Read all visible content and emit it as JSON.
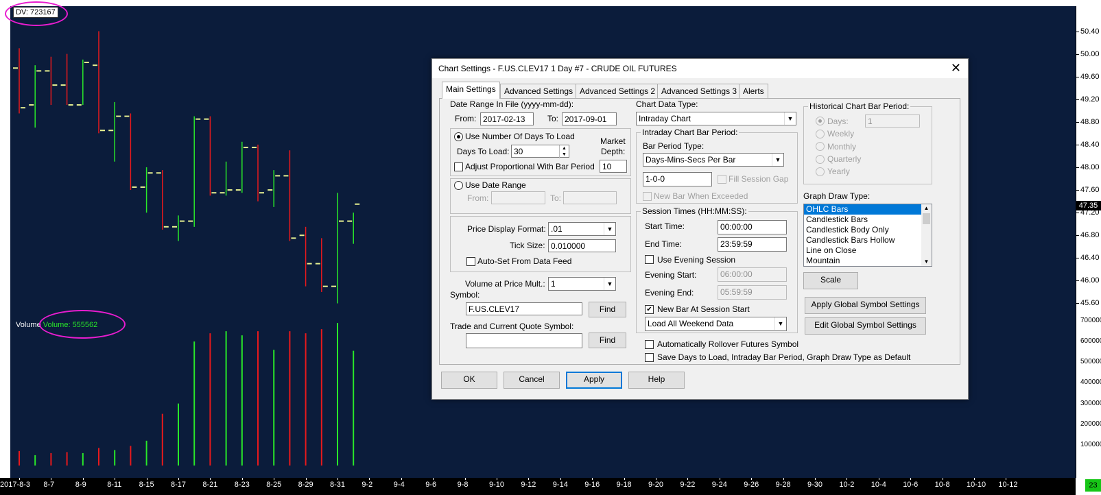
{
  "chart": {
    "dv_label": "DV: 723167",
    "volume_prefix": "Volume",
    "volume_value": "Volume: 555562",
    "last_price": "47.35",
    "last_date_marker": "23",
    "price_labels": [
      "50.40",
      "50.00",
      "49.60",
      "49.20",
      "48.80",
      "48.40",
      "48.00",
      "47.60",
      "47.20",
      "46.80",
      "46.40",
      "46.00",
      "45.60"
    ],
    "volume_labels": [
      "700000",
      "600000",
      "500000",
      "400000",
      "300000",
      "200000",
      "100000"
    ],
    "date_labels": [
      "2017-8-3",
      "8-7",
      "8-9",
      "8-11",
      "8-15",
      "8-17",
      "8-21",
      "8-23",
      "8-25",
      "8-29",
      "8-31",
      "9-2",
      "9-4",
      "9-6",
      "9-8",
      "9-10",
      "9-12",
      "9-14",
      "9-16",
      "9-18",
      "9-20",
      "9-22",
      "9-24",
      "9-26",
      "9-28",
      "9-30",
      "10-2",
      "10-4",
      "10-6",
      "10-8",
      "10-10",
      "10-12"
    ],
    "colors": {
      "up": "#29e829",
      "down": "#e8191c",
      "tick": "#e8f291",
      "bg": "#0b1c3b",
      "highlight": "#e81ccf"
    }
  },
  "chart_data": {
    "type": "ohlc",
    "ylim": [
      45.4,
      50.6
    ],
    "bars": [
      {
        "date": "2017-8-3",
        "open": 49.75,
        "high": 50.1,
        "low": 48.95,
        "close": 49.05,
        "volume": 70000,
        "dir": "down"
      },
      {
        "date": "8-4",
        "open": 49.1,
        "high": 49.8,
        "low": 48.7,
        "close": 49.7,
        "volume": 50000,
        "dir": "up"
      },
      {
        "date": "8-7",
        "open": 49.7,
        "high": 49.95,
        "low": 49.1,
        "close": 49.45,
        "volume": 60000,
        "dir": "down"
      },
      {
        "date": "8-8",
        "open": 49.45,
        "high": 50.0,
        "low": 49.1,
        "close": 49.1,
        "volume": 65000,
        "dir": "down"
      },
      {
        "date": "8-9",
        "open": 49.1,
        "high": 49.9,
        "low": 49.1,
        "close": 49.85,
        "volume": 60000,
        "dir": "up"
      },
      {
        "date": "8-10",
        "open": 49.8,
        "high": 50.4,
        "low": 48.6,
        "close": 48.65,
        "volume": 85000,
        "dir": "down"
      },
      {
        "date": "8-11",
        "open": 48.65,
        "high": 49.15,
        "low": 48.1,
        "close": 48.9,
        "volume": 75000,
        "dir": "up"
      },
      {
        "date": "8-14",
        "open": 48.9,
        "high": 48.95,
        "low": 47.6,
        "close": 47.65,
        "volume": 95000,
        "dir": "down"
      },
      {
        "date": "8-15",
        "open": 47.65,
        "high": 48.0,
        "low": 47.2,
        "close": 47.9,
        "volume": 120000,
        "dir": "up"
      },
      {
        "date": "8-16",
        "open": 47.9,
        "high": 47.95,
        "low": 46.9,
        "close": 46.95,
        "volume": 250000,
        "dir": "down"
      },
      {
        "date": "8-17",
        "open": 46.95,
        "high": 47.15,
        "low": 46.7,
        "close": 47.05,
        "volume": 300000,
        "dir": "up"
      },
      {
        "date": "8-18",
        "open": 47.05,
        "high": 48.9,
        "low": 46.95,
        "close": 48.85,
        "volume": 600000,
        "dir": "up"
      },
      {
        "date": "8-21",
        "open": 48.85,
        "high": 48.9,
        "low": 47.5,
        "close": 47.55,
        "volume": 640000,
        "dir": "down"
      },
      {
        "date": "8-22",
        "open": 47.55,
        "high": 48.1,
        "low": 47.5,
        "close": 47.6,
        "volume": 650000,
        "dir": "up"
      },
      {
        "date": "8-23",
        "open": 47.6,
        "high": 48.45,
        "low": 47.55,
        "close": 48.35,
        "volume": 630000,
        "dir": "up"
      },
      {
        "date": "8-24",
        "open": 48.35,
        "high": 48.4,
        "low": 47.4,
        "close": 47.55,
        "volume": 650000,
        "dir": "down"
      },
      {
        "date": "8-25",
        "open": 47.6,
        "high": 47.95,
        "low": 47.3,
        "close": 47.85,
        "volume": 560000,
        "dir": "up"
      },
      {
        "date": "8-28",
        "open": 47.85,
        "high": 48.3,
        "low": 46.7,
        "close": 46.75,
        "volume": 650000,
        "dir": "down"
      },
      {
        "date": "8-29",
        "open": 46.8,
        "high": 46.95,
        "low": 45.9,
        "close": 46.3,
        "volume": 640000,
        "dir": "down"
      },
      {
        "date": "8-30",
        "open": 46.3,
        "high": 46.75,
        "low": 45.8,
        "close": 45.9,
        "volume": 660000,
        "dir": "down"
      },
      {
        "date": "8-31",
        "open": 45.9,
        "high": 47.55,
        "low": 45.6,
        "close": 47.05,
        "volume": 690000,
        "dir": "up"
      },
      {
        "date": "9-1",
        "open": 47.05,
        "high": 47.2,
        "low": 46.65,
        "close": 47.35,
        "volume": 555562,
        "dir": "up"
      }
    ]
  },
  "dialog": {
    "title": "Chart Settings - F.US.CLEV17  1 Day   #7 - CRUDE OIL FUTURES",
    "tabs": [
      "Main Settings",
      "Advanced Settings",
      "Advanced Settings 2",
      "Advanced Settings 3",
      "Alerts"
    ],
    "date_range_label": "Date Range In File (yyyy-mm-dd):",
    "from_label": "From:",
    "from_value": "2017-02-13",
    "to_label": "To:",
    "to_value": "2017-09-01",
    "use_days_label": "Use Number Of Days To Load",
    "days_to_load_label": "Days To Load:",
    "days_to_load_value": "30",
    "market_depth_label_1": "Market",
    "market_depth_label_2": "Depth:",
    "market_depth_value": "10",
    "adjust_label": "Adjust Proportional With Bar Period",
    "use_date_range_label": "Use Date Range",
    "dr_from_label": "From:",
    "dr_to_label": "To:",
    "price_display_label": "Price Display Format:",
    "price_display_value": ".01",
    "tick_size_label": "Tick Size:",
    "tick_size_value": "0.010000",
    "auto_set_label": "Auto-Set From Data Feed",
    "vol_at_price_label": "Volume at Price Mult.:",
    "vol_at_price_value": "1",
    "symbol_label": "Symbol:",
    "symbol_value": "F.US.CLEV17",
    "find_label": "Find",
    "trade_symbol_label": "Trade and Current Quote Symbol:",
    "trade_symbol_value": "",
    "chart_data_type_label": "Chart Data Type:",
    "chart_data_type_value": "Intraday Chart",
    "intraday_bar_period_label": "Intraday Chart Bar Period:",
    "bar_period_type_label": "Bar Period Type:",
    "bar_period_type_value": "Days-Mins-Secs Per Bar",
    "bar_period_value": "1-0-0",
    "fill_session_gap_label": "Fill Session Gap",
    "new_bar_exceeded_label": "New Bar When Exceeded",
    "session_times_label": "Session Times (HH:MM:SS):",
    "start_time_label": "Start Time:",
    "start_time_value": "00:00:00",
    "end_time_label": "End Time:",
    "end_time_value": "23:59:59",
    "use_evening_label": "Use Evening Session",
    "evening_start_label": "Evening Start:",
    "evening_start_value": "06:00:00",
    "evening_end_label": "Evening End:",
    "evening_end_value": "05:59:59",
    "new_bar_session_label": "New Bar At Session Start",
    "weekend_value": "Load All Weekend Data",
    "historical_label": "Historical Chart Bar Period:",
    "hist_options": [
      "Days:",
      "Weekly",
      "Monthly",
      "Quarterly",
      "Yearly"
    ],
    "hist_days_value": "1",
    "graph_draw_type_label": "Graph Draw Type:",
    "graph_draw_types": [
      "OHLC Bars",
      "Candlestick Bars",
      "Candlestick Body Only",
      "Candlestick Bars Hollow",
      "Line on Close",
      "Mountain"
    ],
    "scale_label": "Scale",
    "apply_global_label": "Apply Global Symbol Settings",
    "edit_global_label": "Edit Global Symbol Settings",
    "auto_rollover_label": "Automatically Rollover Futures Symbol",
    "save_defaults_label": "Save Days to Load, Intraday Bar Period, Graph Draw Type as Default",
    "ok_label": "OK",
    "cancel_label": "Cancel",
    "apply_label": "Apply",
    "help_label": "Help",
    "close_glyph": "✕"
  }
}
